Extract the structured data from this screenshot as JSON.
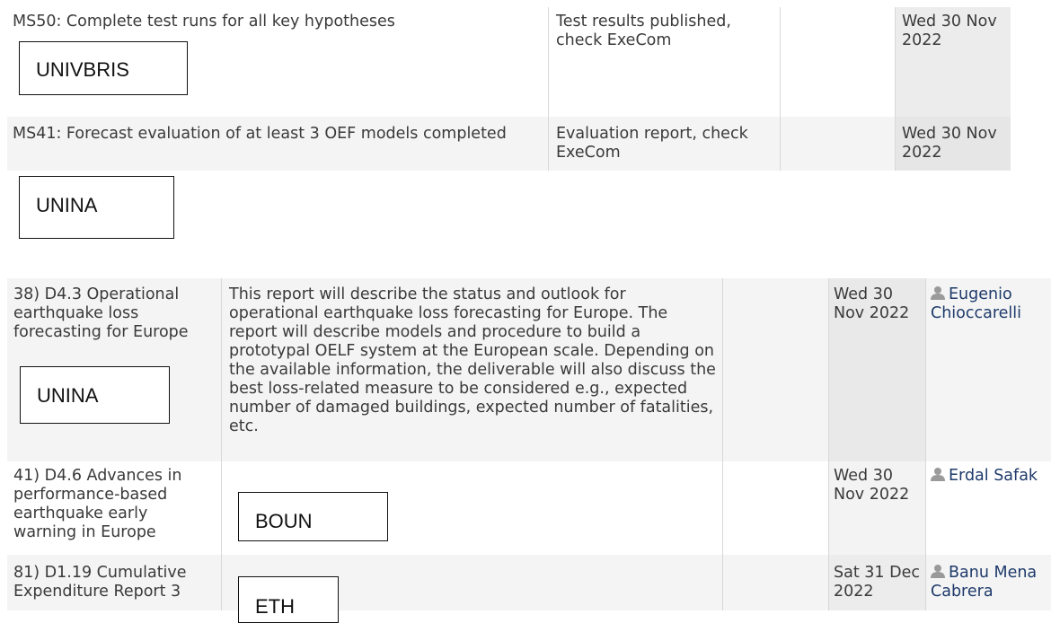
{
  "milestones": [
    {
      "title": "MS50: Complete test runs for all key hypotheses",
      "verification": "Test results published, check ExeCom",
      "due": "Wed 30 Nov 2022",
      "tag": "UNIVBRIS"
    },
    {
      "title": "MS41: Forecast evaluation of at least 3 OEF models completed",
      "verification": "Evaluation report, check ExeCom",
      "due": "Wed 30 Nov 2022",
      "tag": "UNINA"
    }
  ],
  "deliverables": [
    {
      "title": "38) D4.3 Operational earthquake loss forecasting for Europe",
      "description": "This report will describe the status and outlook for operational earthquake loss forecasting for Europe. The report will describe models and procedure to build a prototypal OELF system at the European scale. Depending on the available information, the deliverable will also discuss the best loss-related measure to be considered e.g., expected number of damaged buildings, expected number of fatalities, etc.",
      "due": "Wed 30 Nov 2022",
      "person": "Eugenio Chioccarelli",
      "tag": "UNINA",
      "icon": "person-icon"
    },
    {
      "title": "41) D4.6 Advances in performance-based earthquake early warning in Europe",
      "description": "",
      "due": "Wed 30 Nov 2022",
      "person": "Erdal Safak",
      "tag": "BOUN",
      "icon": "person-icon"
    },
    {
      "title": "81) D1.19 Cumulative Expenditure Report 3",
      "description": "",
      "due": "Sat 31 Dec 2022",
      "person": "Banu Mena Cabrera",
      "tag": "ETH",
      "icon": "person-icon"
    }
  ],
  "colors": {
    "row_alt": "#f4f4f4",
    "due_bg": "#ececec",
    "text": "#3a3a3a",
    "person_text": "#1e3a6b",
    "icon": "#9a9a9a"
  }
}
